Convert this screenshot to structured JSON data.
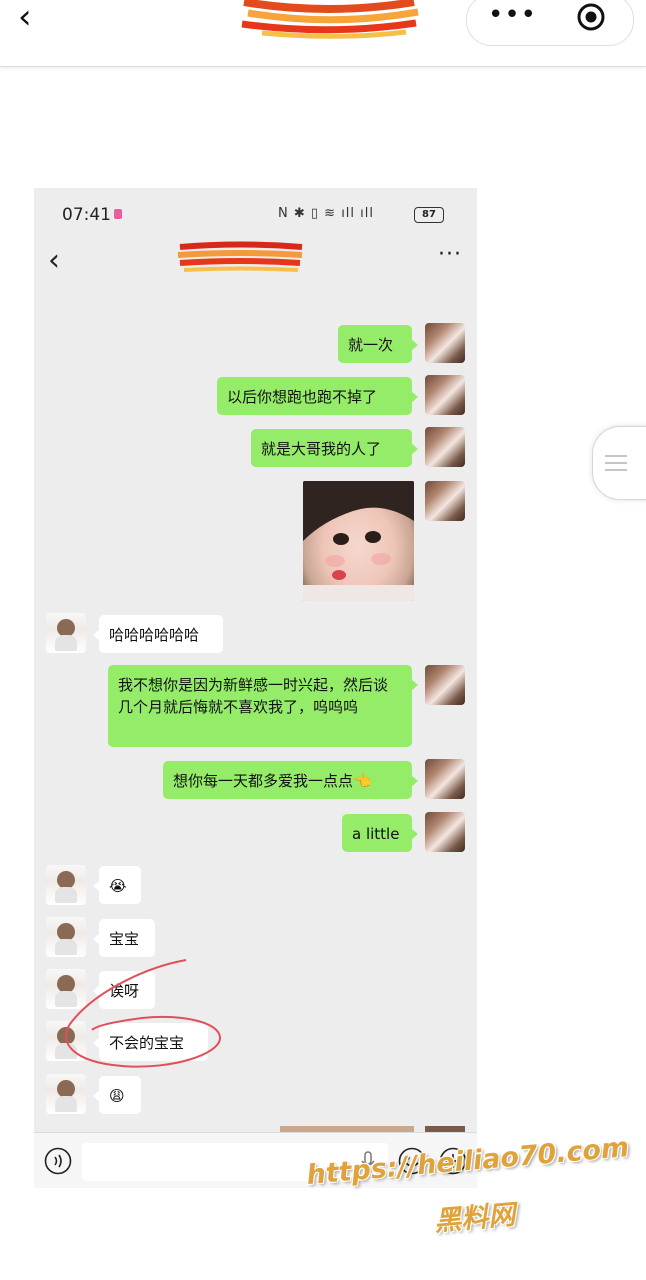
{
  "browser": {
    "back_icon": "chevron-left-icon",
    "title_redacted": true,
    "more_icon": "more-dots-icon",
    "target_icon": "close-mini-program-icon"
  },
  "phone": {
    "status": {
      "time": "07:41",
      "battery": "87"
    },
    "chat_header": {
      "title_redacted": true,
      "back_icon": "chevron-left-icon",
      "menu_icon": "more-dots-icon"
    },
    "messages": [
      {
        "from": "me",
        "text": "就一次"
      },
      {
        "from": "me",
        "text": "以后你想跑也跑不掉了"
      },
      {
        "from": "me",
        "text": "就是大哥我的人了"
      },
      {
        "from": "me",
        "type": "image"
      },
      {
        "from": "other",
        "text": "哈哈哈哈哈哈"
      },
      {
        "from": "me",
        "text": "我不想你是因为新鲜感一时兴起，然后谈几个月就后悔就不喜欢我了，呜呜呜"
      },
      {
        "from": "me",
        "text": "想你每一天都多爱我一点点👈"
      },
      {
        "from": "me",
        "text": "a little"
      },
      {
        "from": "other",
        "text": "😭"
      },
      {
        "from": "other",
        "text": "宝宝"
      },
      {
        "from": "other",
        "text": "诶呀"
      },
      {
        "from": "other",
        "text": "不会的宝宝"
      },
      {
        "from": "other",
        "text": "😩"
      }
    ],
    "input_bar": {
      "voice_icon": "voice-icon",
      "mic_icon": "mic-icon",
      "emoji_icon": "emoji-icon",
      "plus_icon": "plus-icon"
    }
  },
  "watermark": {
    "url": "https://heiliao70.com",
    "label": "黑料网"
  },
  "colors": {
    "my_bubble": "#95ec69",
    "other_bubble": "#ffffff",
    "chat_bg": "#ededed",
    "annotation": "#e0505a"
  }
}
